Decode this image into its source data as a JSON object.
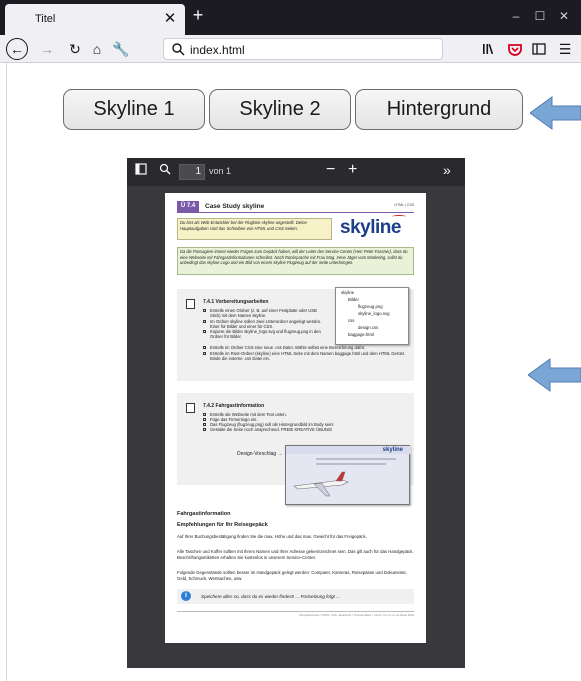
{
  "browser": {
    "tab_title": "Titel",
    "url": "index.html"
  },
  "buttons": [
    {
      "label": "Skyline 1"
    },
    {
      "label": "Skyline 2"
    },
    {
      "label": "Hintergrund"
    }
  ],
  "pdf_viewer": {
    "page_number": "1",
    "page_count": "von 1"
  },
  "document": {
    "header_number": "Ü 7.4",
    "header_title": "Case Study skyline",
    "header_tag": "HTML | CSS",
    "intro": "Du bist als Web-Entwickler bei der Fluglinie skyline angestellt. Deine Hauptaufgaben sind das Schreiben von HTML und CSS Seiten.",
    "logo_text": "skyline",
    "context": "Da die Passagiere immer wieder Fragen zum Gepäck haben, will der Leiter des Service Center (Herr Peter Fassner), dass du eine Webseite mit Fahrgastinformationen schreibst. Nach Rücksprache mit Frau Mag. Irene Jäger vom Marketing, sollst du unbedingt das skyline Logo und ein Bild von einem skyline Flugzeug auf der Seite unterbringen.",
    "section1_title": "7.4.1 Vorbereitungsarbeiten",
    "section1_items": [
      "Erstelle einen Ordner (z. B. auf einer Festplatte oder USB Stick) mit dem Namen skyline.",
      "Im Ordner skyline sollen zwei Unterordner angelegt werden. Einer für Bilder und einer für CSS.",
      "Kopiere die Bilder skyline_logo.svg und flugzeug.png in den Ordner für Bilder.",
      "Erstelle im Ordner CSS eine neue .css Datei. Wähle selbst eine Bezeichnung dafür.",
      "Erstelle im Root-Ordner (skyline) eine HTML Seite mit dem Namen baggage.html und dem HTML Gerüst. Binde die externe .css Datei ein."
    ],
    "tree": [
      "skyline",
      "Bilder",
      "flugzeug.png",
      "skyline_logo.svg",
      "css",
      "design.css",
      "baggage.html"
    ],
    "section2_title": "7.4.2 Fahrgastinformation",
    "section2_items": [
      "Erstelle die Webseite mit dem Text unten.",
      "Füge das Firmenlogo ein.",
      "Das Flugzeug (flugzeug.png) soll als Hintergrundbild im Body sein!",
      "Gestalte die Seite noch ansprechend. FREIE KREATIVE ÜBUNG!"
    ],
    "design_label": "Design-Vorschlag →",
    "content_heading1": "Fahrgastinformation",
    "content_heading2": "Empfehlungen für Ihr Reisegepäck",
    "paragraph1": "Auf Ihrer Buchungsbestätigung finden Sie die max. Höhe und das max. Gewicht für das Freigepäck.",
    "paragraph2": "Alle Taschen und Koffer sollten mit Ihrem Namen und Ihrer Adresse gekennzeichnet sein. Das gilt auch für das Handgepäck. Beschriftungsetiketten erhalten Sie kostenlos in unserem Service-Center.",
    "paragraph3": "Folgende Gegenstände sollten besser im Handgepäck gelegt werden: Computer, Kameras, Reisepässe und Dokumente, Geld, Schmuck, Wertsachen, usw.",
    "info_note": "Speichere alles so, dass du es wieder findest! ... Fortsetzung folgt ...",
    "footer": "Übungsbeispiele | HTML, CSS, JavaScript | Thomas Maier | Lizenz: CC by-nc-sa Stand 2019"
  },
  "colors": {
    "titlebar": "#1c1b22",
    "toolbar": "#f0f0f4",
    "accent_purple": "#7a5aa8",
    "logo_blue": "#1d3f8a",
    "logo_red": "#d62828",
    "arrow_blue": "#7aa6d6"
  }
}
